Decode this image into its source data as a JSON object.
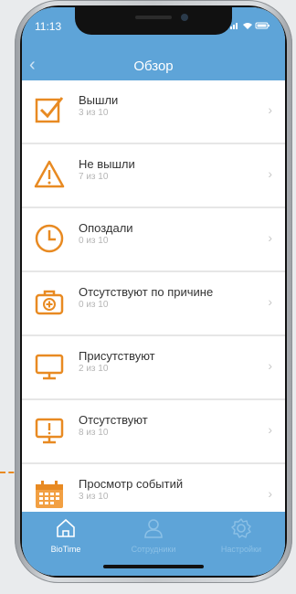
{
  "status": {
    "time": "11:13"
  },
  "header": {
    "title": "Обзор"
  },
  "rows": [
    {
      "label": "Вышли",
      "sub": "3 из 10",
      "icon": "check-box-icon"
    },
    {
      "label": "Не вышли",
      "sub": "7 из 10",
      "icon": "warning-triangle-icon"
    },
    {
      "label": "Опоздали",
      "sub": "0 из 10",
      "icon": "clock-icon"
    },
    {
      "label": "Отсутствуют по причине",
      "sub": "0 из 10",
      "icon": "medical-kit-icon"
    },
    {
      "label": "Присутствуют",
      "sub": "2 из 10",
      "icon": "monitor-icon"
    },
    {
      "label": "Отсутствуют",
      "sub": "8 из 10",
      "icon": "monitor-alert-icon"
    },
    {
      "label": "Просмотр событий",
      "sub": "3 из 10",
      "icon": "calendar-icon"
    }
  ],
  "tabs": [
    {
      "label": "BioTime",
      "icon": "home-icon",
      "active": true
    },
    {
      "label": "Сотрудники",
      "icon": "user-icon",
      "active": false
    },
    {
      "label": "Настройки",
      "icon": "gear-icon",
      "active": false
    }
  ],
  "colors": {
    "header": "#5ea4d8",
    "accent": "#e88a22"
  }
}
